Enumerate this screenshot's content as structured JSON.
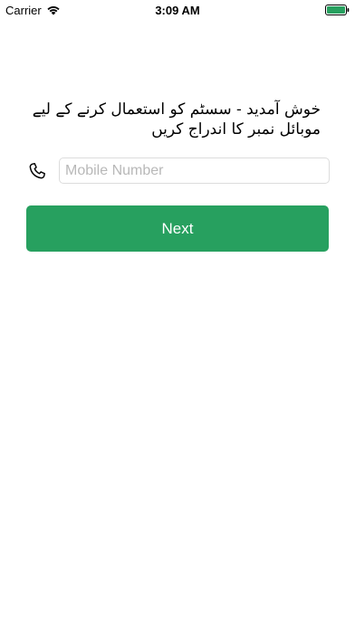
{
  "status_bar": {
    "carrier": "Carrier",
    "time": "3:09 AM",
    "wifi_icon": "wifi-icon",
    "battery_icon": "battery-full-icon",
    "battery_color": "#27a05f"
  },
  "welcome": {
    "text": "خوش آمدید - سسٹم کو استعمال کرنے کے لیے موبائل نمبر کا اندراج کریں"
  },
  "mobile": {
    "icon": "phone-icon",
    "placeholder": "Mobile Number",
    "value": ""
  },
  "next_button": {
    "label": "Next",
    "color": "#27a05f"
  }
}
